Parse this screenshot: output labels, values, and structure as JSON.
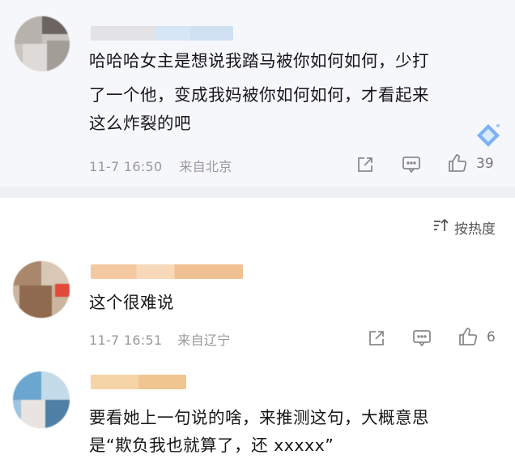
{
  "comments": [
    {
      "text_line1": "哈哈哈女主是想说我踏马被你如何如何，少打",
      "text_line2": "了一个他，变成我妈被你如何如何，才看起来",
      "text_line3": "这么炸裂的吧",
      "time": "11-7 16:50",
      "location": "来自北京",
      "likes": "39"
    },
    {
      "text_line1": "这个很难说",
      "time": "11-7 16:51",
      "location": "来自辽宁",
      "likes": "6"
    },
    {
      "text_line1": "要看她上一句说的啥，来推测这句，大概意思",
      "text_line2": "是“欺负我也就算了，还 xxxxx”"
    }
  ],
  "sort": {
    "label": "按热度"
  },
  "icons": {
    "share": "share-icon",
    "comment": "comment-icon",
    "like": "thumbs-up-icon",
    "sort": "sort-icon",
    "badge": "diamond-badge-icon"
  },
  "colors": {
    "meta_gray": "#9a9a9a",
    "card_bg": "#f6f7fb",
    "divider": "#eef0f3"
  }
}
